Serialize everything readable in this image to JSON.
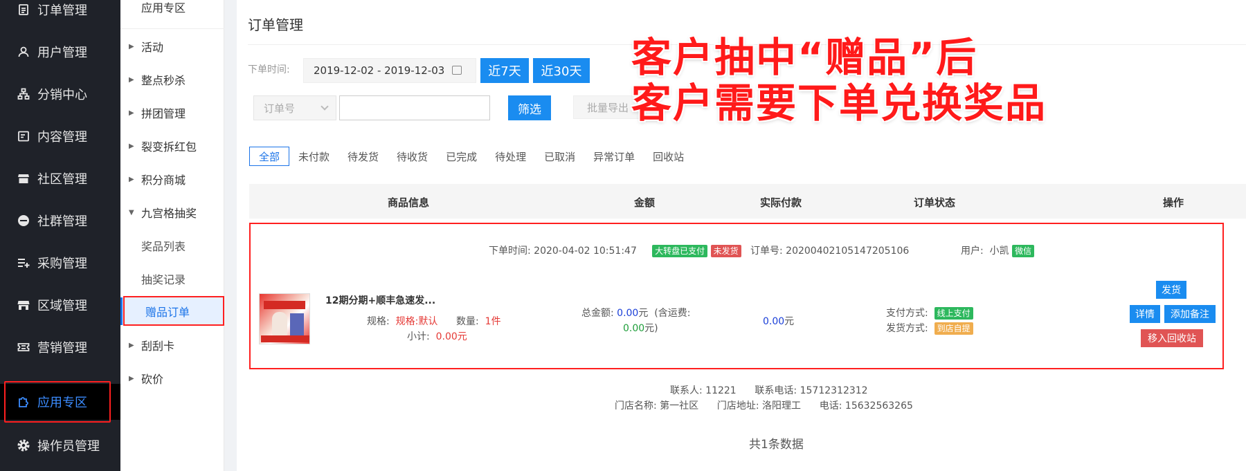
{
  "sidebar": {
    "items": [
      {
        "label": "订单管理",
        "icon": "clipboard-icon"
      },
      {
        "label": "用户管理",
        "icon": "user-icon"
      },
      {
        "label": "分销中心",
        "icon": "org-chart-icon"
      },
      {
        "label": "内容管理",
        "icon": "document-icon"
      },
      {
        "label": "社区管理",
        "icon": "store-icon"
      },
      {
        "label": "社群管理",
        "icon": "minus-circle-icon"
      },
      {
        "label": "采购管理",
        "icon": "list-plus-icon"
      },
      {
        "label": "区域管理",
        "icon": "shop-icon"
      },
      {
        "label": "营销管理",
        "icon": "ticket-icon"
      },
      {
        "label": "应用专区",
        "icon": "puzzle-icon"
      },
      {
        "label": "操作员管理",
        "icon": "gear-icon"
      }
    ]
  },
  "submenu": {
    "header": "应用专区",
    "items": [
      {
        "label": "活动"
      },
      {
        "label": "整点秒杀"
      },
      {
        "label": "拼团管理"
      },
      {
        "label": "裂变拆红包"
      },
      {
        "label": "积分商城"
      },
      {
        "label": "九宫格抽奖"
      },
      {
        "label": "奖品列表"
      },
      {
        "label": "抽奖记录"
      },
      {
        "label": "赠品订单"
      },
      {
        "label": "刮刮卡"
      },
      {
        "label": "砍价"
      }
    ]
  },
  "page": {
    "title": "订单管理",
    "overlay_line1": "客户抽中“赠品”后",
    "overlay_line2": "客户需要下单兑换奖品"
  },
  "filters": {
    "time_label": "下单时间:",
    "date_range": "2019-12-02  -  2019-12-03",
    "btn_7days": "近7天",
    "btn_30days": "近30天",
    "select_value": "订单号",
    "search_value": "",
    "btn_filter": "筛选",
    "btn_export": "批量导出"
  },
  "tabs": [
    "全部",
    "未付款",
    "待发货",
    "待收货",
    "已完成",
    "待处理",
    "已取消",
    "异常订单",
    "回收站"
  ],
  "table": {
    "headers": [
      "商品信息",
      "金额",
      "实际付款",
      "订单状态",
      "操作"
    ]
  },
  "order": {
    "time_label": "下单时间:",
    "time_value": "2020-04-02 10:51:47",
    "badge_paid": "大转盘已支付",
    "badge_unshipped": "未发货",
    "order_no_label": "订单号:",
    "order_no": "20200402105147205106",
    "user_label": "用户:",
    "user_name": "小凯",
    "badge_wechat": "微信",
    "product_name": "12期分期+顺丰急速发...",
    "spec_label": "规格:",
    "spec_value": "规格:默认",
    "qty_label": "数量:",
    "qty_value": "1件",
    "subtotal_label": "小计:",
    "subtotal_value": "0.00元",
    "total_label": "总金额:",
    "total_value": "0.00",
    "total_unit": "元",
    "shipping_prefix": "(含运费:",
    "shipping_value": "0.00",
    "shipping_suffix": "元)",
    "paid_value": "0.00",
    "paid_unit": "元",
    "pay_method_label": "支付方式:",
    "pay_method": "线上支付",
    "ship_method_label": "发货方式:",
    "ship_method": "到店自提",
    "btn_ship": "发货",
    "btn_detail": "详情",
    "btn_note": "添加备注",
    "btn_recycle": "移入回收站"
  },
  "contact": {
    "person_label": "联系人:",
    "person": "11221",
    "phone_label": "联系电话:",
    "phone": "15712312312",
    "store_label": "门店名称:",
    "store": "第一社区",
    "addr_label": "门店地址:",
    "addr": "洛阳理工",
    "tel_label": "电话:",
    "tel": "15632563265"
  },
  "footer": {
    "total": "共1条数据"
  }
}
